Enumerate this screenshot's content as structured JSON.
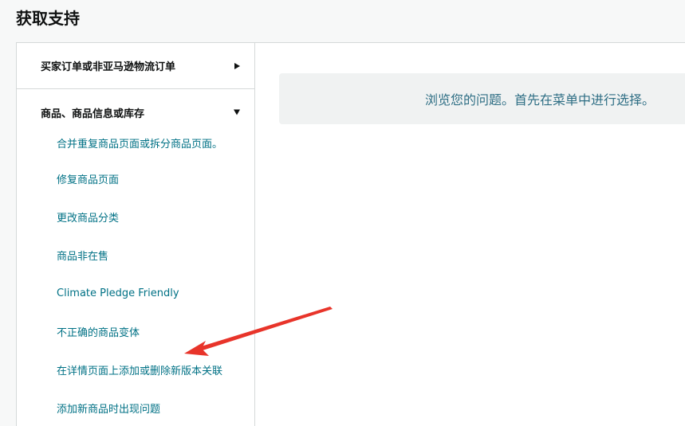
{
  "page": {
    "title": "获取支持"
  },
  "sidebar": {
    "sections": [
      {
        "label": "买家订单或非亚马逊物流订单",
        "expanded": false
      },
      {
        "label": "商品、商品信息或库存",
        "expanded": true
      }
    ],
    "items": [
      "合并重复商品页面或拆分商品页面。",
      "修复商品页面",
      "更改商品分类",
      "商品非在售",
      "Climate Pledge Friendly",
      "不正确的商品变体",
      "在详情页面上添加或删除新版本关联",
      "添加新商品时出现问题"
    ]
  },
  "main": {
    "message": "浏览您的问题。首先在菜单中进行选择。"
  },
  "colors": {
    "link": "#007185",
    "text": "#0f1111",
    "border": "#d5d9d9",
    "message_text": "#2f6f85",
    "message_bg": "#f0f2f2",
    "annotation_arrow": "#e8342a"
  },
  "icons": {
    "collapsed": "caret-right-icon",
    "expanded": "caret-down-icon"
  }
}
